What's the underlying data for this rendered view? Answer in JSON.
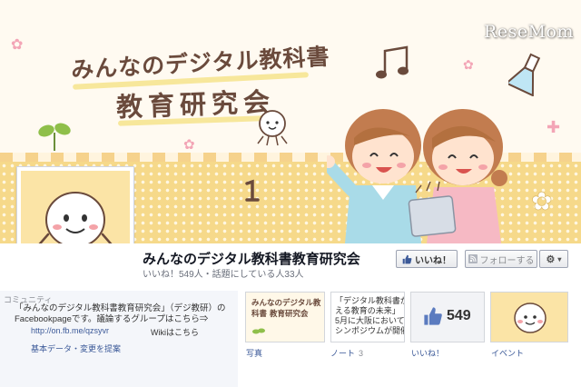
{
  "watermark": "ReseMom",
  "cover": {
    "title_line_1": "みんなのデジタル教科書",
    "title_line_2": "教育研究会"
  },
  "page": {
    "title": "みんなのデジタル教科書教育研究会",
    "stats": "いいね！549人・話題にしている人33人"
  },
  "actions": {
    "like_label": "いいね！",
    "follow_label": "フォローする",
    "gear_label": "▾"
  },
  "about": {
    "category": "コミュニティ",
    "description": "「みんなのデジタル教科書教育研究会」（デジ教研）のFacebookpageです。議論するグループはこちら⇒",
    "link": "http://on.fb.me/qzsyvr",
    "wiki": "Wikiはこちら",
    "basic_info": "基本データ・変更を提案"
  },
  "tiles": [
    {
      "label": "写真",
      "count": "",
      "preview": "みんなのデジタル教科書 教育研究会"
    },
    {
      "label": "ノート",
      "count": "3",
      "preview": [
        "「デジタル教科書が",
        "える教育の未来」",
        "5月に大阪において",
        "シンポジウムが開催"
      ]
    },
    {
      "label": "いいね！",
      "count": "",
      "preview": "549"
    },
    {
      "label": "イベント",
      "count": "",
      "preview": ""
    }
  ],
  "colors": {
    "link": "#3b5998",
    "cover_bg": "#fffaf1",
    "dots": "#f6d98a",
    "title_brown": "#6a4a3c"
  },
  "icons": [
    "thumbs-up-icon",
    "gear-icon",
    "music-note-icon",
    "flask-icon",
    "sprout-icon",
    "flower-icon"
  ]
}
